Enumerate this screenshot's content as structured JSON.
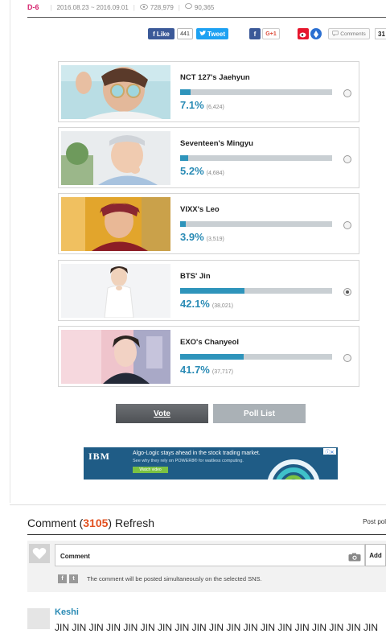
{
  "header": {
    "dday": "D-6",
    "period": "2016.08.23 ~ 2016.09.01",
    "views": "728,979",
    "comments": "90,365"
  },
  "share": {
    "like_label": "Like",
    "like_count": "441",
    "tweet_label": "Tweet",
    "gplus_label": "G+1",
    "comments_label": "Comments",
    "comments_count": "31"
  },
  "poll": {
    "items": [
      {
        "name": "NCT 127's Jaehyun",
        "percent": "7.1%",
        "votes": "(6,424)",
        "selected": false
      },
      {
        "name": "Seventeen's Mingyu",
        "percent": "5.2%",
        "votes": "(4,684)",
        "selected": false
      },
      {
        "name": "VIXX's Leo",
        "percent": "3.9%",
        "votes": "(3,519)",
        "selected": false
      },
      {
        "name": "BTS' Jin",
        "percent": "42.1%",
        "votes": "(38,021)",
        "selected": true
      },
      {
        "name": "EXO's Chanyeol",
        "percent": "41.7%",
        "votes": "(37,717)",
        "selected": false
      }
    ],
    "vote_label": "Vote",
    "poll_list_label": "Poll List"
  },
  "ad": {
    "brand": "IBM",
    "headline": "Algo-Logic stays ahead in the stock trading market.",
    "sub": "See why they rely on POWER8® for waitless computing.",
    "cta": "Watch video"
  },
  "comment": {
    "title": "Comment",
    "count": "3105",
    "refresh": "Refresh",
    "post_policy": "Post pol",
    "input_label": "Comment",
    "add_label": "Add",
    "sns_note": "The comment will be posted simultaneously on the selected SNS."
  },
  "entries": [
    {
      "author": "Keshi",
      "text": "JIN JIN JIN JIN JIN JIN JIN JIN JIN JIN JIN JIN JIN JIN JIN JIN JIN JIN JIN"
    }
  ]
}
